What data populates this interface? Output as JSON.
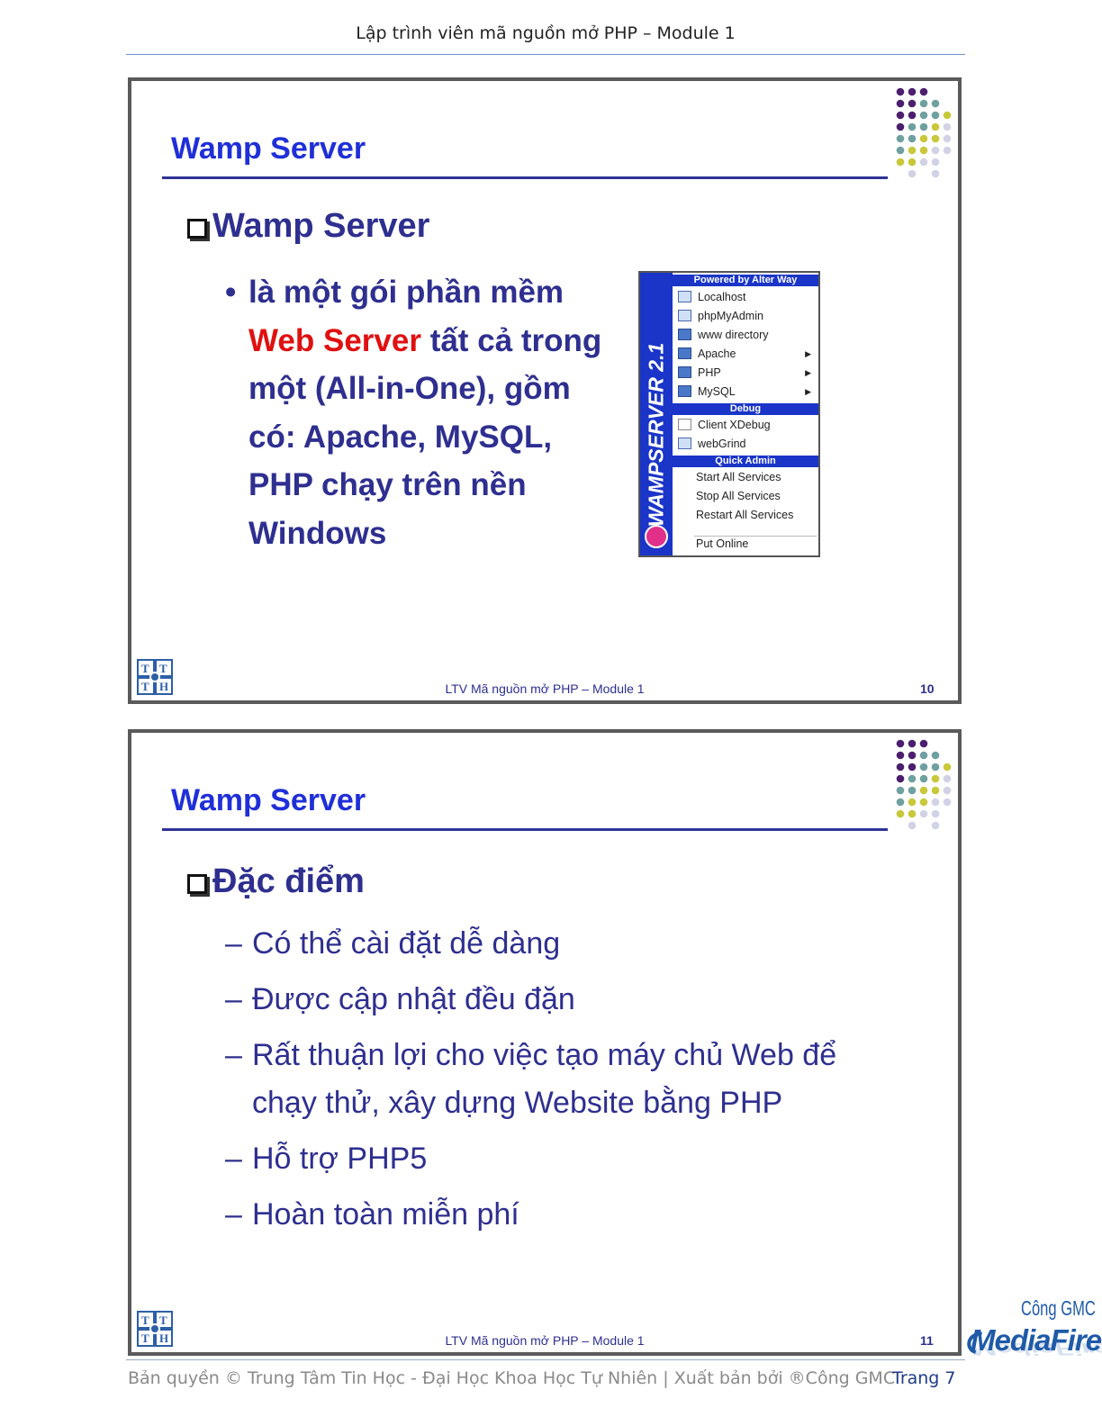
{
  "header": {
    "title": "Lập trình viên mã nguồn mở PHP – Module 1"
  },
  "slides": [
    {
      "title": "Wamp Server",
      "heading": "Wamp Server",
      "bullet_before": "là một gói phần mềm",
      "bullet_highlight": "Web Server",
      "bullet_after": "tất cả trong một (All-in-One), gồm có: Apache, MySQL, PHP chạy trên nền Windows",
      "footer": "LTV Mã nguồn mở PHP – Module 1",
      "page": "10"
    },
    {
      "title": "Wamp Server",
      "heading": "Đặc điểm",
      "items": [
        "Có thể cài đặt dễ dàng",
        "Được cập nhật đều đặn",
        "Rất thuận lợi cho việc tạo máy chủ Web để chạy thử, xây dựng Website bằng PHP",
        "Hỗ trợ PHP5",
        "Hoàn toàn miễn phí"
      ],
      "footer": "LTV Mã nguồn mở PHP – Module 1",
      "page": "11"
    }
  ],
  "wamp_menu": {
    "side_label": "WAMPSERVER 2.1",
    "top_header": "Powered by Alter Way",
    "main_items": [
      "Localhost",
      "phpMyAdmin",
      "www directory",
      "Apache",
      "PHP",
      "MySQL"
    ],
    "debug_header": "Debug",
    "debug_items": [
      "Client XDebug",
      "webGrind"
    ],
    "admin_header": "Quick Admin",
    "admin_items": [
      "Start All Services",
      "Stop All Services",
      "Restart All Services"
    ],
    "online_item": "Put Online"
  },
  "logo": {
    "letters": [
      "T",
      "T",
      "T",
      "H"
    ]
  },
  "footer": {
    "copyright": "Bản quyền © Trung Tâm Tin Học - Đại Học Khoa Học Tự Nhiên | Xuất bản bởi ®Công GMC",
    "page": "Trang 7"
  },
  "watermark": {
    "top": "Công GMC",
    "brand": "MediaFire"
  },
  "colors": {
    "title_blue": "#1f2fd8",
    "text_navy": "#2e2f8f",
    "highlight_red": "#e01010",
    "dot_purple": "#4b1e6e",
    "dot_teal": "#6fa0a0",
    "dot_yellow": "#c8c83a",
    "dot_lavender": "#d2d2e6"
  }
}
